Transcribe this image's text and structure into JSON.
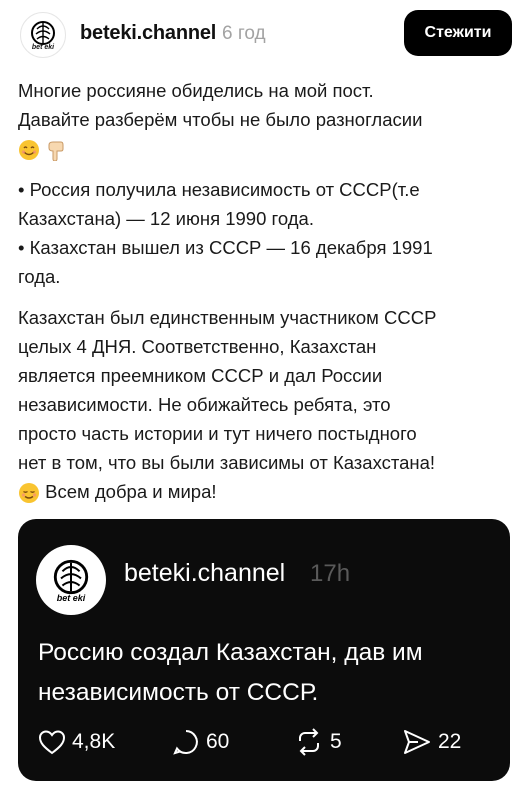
{
  "header": {
    "avatar_logo_text": "bet eki",
    "username": "beteki.channel",
    "time": "6 год",
    "follow_label": "Стежити"
  },
  "post": {
    "paragraph1": [
      "Многие россияне обиделись на мой пост.",
      "Давайте разберём чтобы не было разногласии"
    ],
    "paragraph1_emojis": [
      "smiling-face",
      "pointing-down-hand"
    ],
    "paragraph2": [
      "• Россия получила независимость от СССР(т.е",
      "Казахстана) — 12 июня 1990 года.",
      "• Казахстан вышел из СССР — 16 декабря 1991",
      "года."
    ],
    "paragraph3": [
      "Казахстан был единственным участником СССР",
      "целых 4 ДНЯ. Соответственно, Казахстан",
      "является преемником СССР и дал России",
      "независимости. Не обижайтесь ребята, это",
      "просто часть истории и тут ничего постыдного",
      "нет в том, что вы были зависимы от Казахстана!"
    ],
    "last_line": "Всем добра и мира!",
    "last_line_emoji": "relieved-face"
  },
  "quoted_post": {
    "avatar_logo_text": "bet eki",
    "username": "beteki.channel",
    "time": "17h",
    "text": [
      "Россию создал Казахстан, дав им",
      "независимость от СССР."
    ],
    "actions": {
      "likes": "4,8K",
      "comments": "60",
      "reposts": "5",
      "shares": "22"
    }
  }
}
